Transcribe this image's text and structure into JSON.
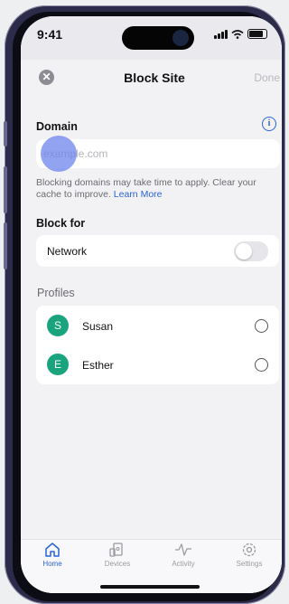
{
  "status_bar": {
    "time": "9:41"
  },
  "sheet": {
    "title": "Block Site",
    "done_label": "Done",
    "close_icon": "close-icon"
  },
  "domain": {
    "label": "Domain",
    "placeholder": "example.com",
    "helper_text": "Blocking domains may take time to apply. Clear your cache to improve.",
    "learn_more": "Learn More"
  },
  "block_for": {
    "label": "Block for",
    "network_label": "Network",
    "network_enabled": false
  },
  "profiles": {
    "label": "Profiles",
    "items": [
      {
        "initial": "S",
        "name": "Susan",
        "selected": false
      },
      {
        "initial": "E",
        "name": "Esther",
        "selected": false
      }
    ]
  },
  "tabbar": {
    "items": [
      {
        "label": "Home",
        "icon": "home-icon",
        "active": true
      },
      {
        "label": "Devices",
        "icon": "devices-icon",
        "active": false
      },
      {
        "label": "Activity",
        "icon": "activity-icon",
        "active": false
      },
      {
        "label": "Settings",
        "icon": "settings-icon",
        "active": false
      }
    ]
  },
  "colors": {
    "accent": "#2a63d6",
    "avatar": "#1aa47e",
    "frame": "#2c2b4a"
  }
}
